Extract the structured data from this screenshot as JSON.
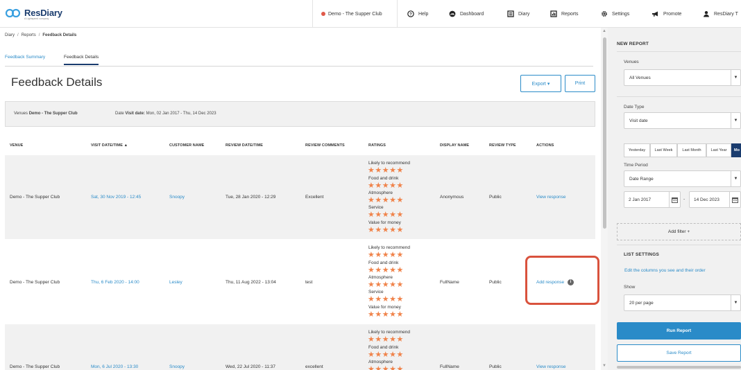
{
  "header": {
    "logo_text": "ResDiary",
    "logo_subtext": "A Lightspeed company",
    "venue_selector": "Demo - The Supper Club",
    "nav": [
      {
        "label": "Help",
        "icon": "help-circle-icon"
      },
      {
        "label": "Dashboard",
        "icon": "dashboard-icon"
      },
      {
        "label": "Diary",
        "icon": "diary-icon"
      },
      {
        "label": "Reports",
        "icon": "reports-icon"
      },
      {
        "label": "Settings",
        "icon": "gear-icon"
      },
      {
        "label": "Promote",
        "icon": "megaphone-icon"
      },
      {
        "label": "ResDiary T",
        "icon": "user-icon"
      }
    ]
  },
  "breadcrumb": {
    "items": [
      "Diary",
      "Reports"
    ],
    "current": "Feedback Details",
    "separator": "/"
  },
  "tabs": [
    {
      "label": "Feedback Summary",
      "active": false
    },
    {
      "label": "Feedback Details",
      "active": true
    }
  ],
  "page": {
    "title": "Feedback Details",
    "export_label": "Export ▾",
    "print_label": "Print"
  },
  "filter_summary": {
    "venues_label": "Venues",
    "venues_value": "Demo - The Supper Club",
    "date_label": "Date",
    "date_type": "Visit date:",
    "date_value": "Mon, 02 Jan 2017 - Thu, 14 Dec 2023"
  },
  "table": {
    "headers": [
      "VENUE",
      "VISIT DATE/TIME ▲",
      "CUSTOMER NAME",
      "REVIEW DATE/TIME",
      "REVIEW COMMENTS",
      "RATINGS",
      "DISPLAY NAME",
      "REVIEW TYPE",
      "ACTIONS"
    ],
    "stars": "★★★★★",
    "rows": [
      {
        "venue": "Demo - The Supper Club",
        "visit": "Sat, 30 Nov 2019 - 12:45",
        "customer": "Snoopy",
        "review_date": "Tue, 28 Jan 2020 - 12:29",
        "comments": "Excellent",
        "ratings": [
          "Likely to recommend",
          "Food and drink",
          "Atmosphere",
          "Service",
          "Value for money"
        ],
        "display_name": "Anonymous",
        "review_type": "Public",
        "action": "View response"
      },
      {
        "venue": "Demo - The Supper Club",
        "visit": "Thu, 6 Feb 2020 - 14:00",
        "customer": "Lesley",
        "review_date": "Thu, 11 Aug 2022 - 13:04",
        "comments": "test",
        "ratings": [
          "Likely to recommend",
          "Food and drink",
          "Atmosphere",
          "Service",
          "Value for money"
        ],
        "display_name": "FullName",
        "review_type": "Public",
        "action": "Add response"
      },
      {
        "venue": "Demo - The Supper Club",
        "visit": "Mon, 6 Jul 2020 - 13:30",
        "customer": "Snoopy",
        "review_date": "Wed, 22 Jul 2020 - 11:37",
        "comments": "excellent",
        "ratings": [
          "Likely to recommend",
          "Food and drink",
          "Atmosphere"
        ],
        "display_name": "FullName",
        "review_type": "Public",
        "action": "View response"
      }
    ]
  },
  "panel": {
    "new_report_title": "NEW REPORT",
    "venues_label": "Venues",
    "venues_value": "All Venues",
    "date_type_label": "Date Type",
    "date_type_value": "Visit date",
    "quick_ranges": [
      "Yesterday",
      "Last Week",
      "Last Month",
      "Last Year",
      "Mo"
    ],
    "time_period_label": "Time Period",
    "time_period_value": "Date Range",
    "date_from": "2 Jan 2017",
    "date_to": "14 Dec 2023",
    "date_separator": "-",
    "add_filter_label": "Add filter +",
    "list_settings_title": "LIST SETTINGS",
    "columns_link": "Edit the columns you see and their order",
    "show_label": "Show",
    "show_value": "20 per page",
    "run_label": "Run Report",
    "save_label": "Save Report"
  },
  "colors": {
    "brand": "#1a3c6e",
    "link": "#2a8bc8",
    "star": "#f0834a",
    "highlight": "#d9523d",
    "live_dot": "#e05a4a"
  }
}
